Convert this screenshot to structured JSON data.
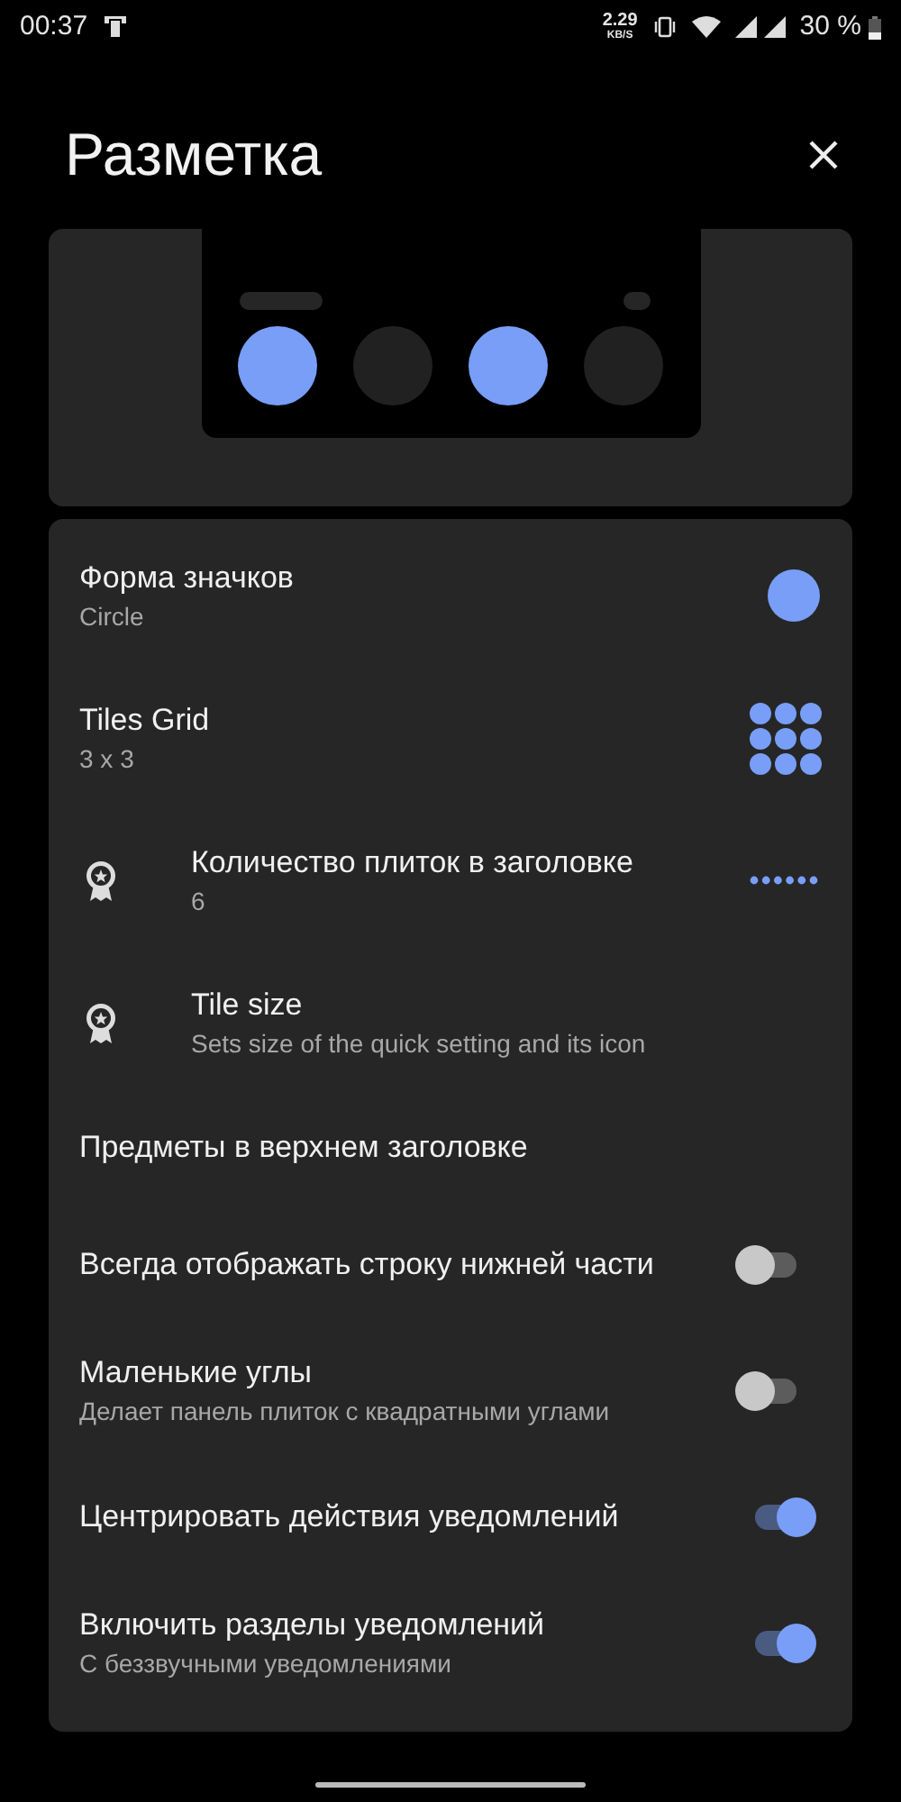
{
  "status_bar": {
    "time": "00:37",
    "speed": "2.29",
    "speed_unit": "KB/S",
    "battery": "30 %"
  },
  "title": "Разметка",
  "preview": {
    "tiles": [
      {
        "on": true
      },
      {
        "on": false
      },
      {
        "on": true
      },
      {
        "on": false
      }
    ]
  },
  "settings": [
    {
      "kind": "shape",
      "title": "Форма значков",
      "subtitle": "Circle"
    },
    {
      "kind": "grid",
      "title": "Tiles Grid",
      "subtitle": "3 x 3"
    },
    {
      "kind": "count",
      "title": "Количество плиток в заголовке",
      "subtitle": "6",
      "badge": true
    },
    {
      "kind": "plain",
      "title": "Tile size",
      "subtitle": "Sets size of the quick setting and its icon",
      "badge": true
    },
    {
      "kind": "plain",
      "title": "Предметы в верхнем заголовке"
    },
    {
      "kind": "toggle",
      "title": "Всегда отображать строку нижней части",
      "on": false
    },
    {
      "kind": "toggle",
      "title": "Маленькие углы",
      "subtitle": "Делает панель плиток с квадратными углами",
      "on": false
    },
    {
      "kind": "toggle",
      "title": "Центрировать действия уведомлений",
      "on": true
    },
    {
      "kind": "toggle",
      "title": "Включить разделы уведомлений",
      "subtitle": "С беззвучными уведомлениями",
      "on": true
    }
  ]
}
